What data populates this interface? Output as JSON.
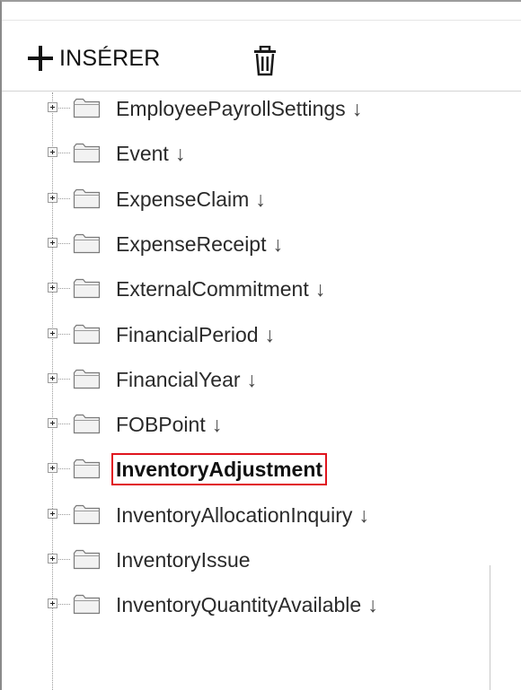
{
  "toolbar": {
    "insert_label": "INSÉRER",
    "insert_icon": "plus-icon",
    "delete_icon": "trash-icon"
  },
  "tree": {
    "sort_arrow": "↓",
    "selected_border_color": "#e0141e",
    "nodes": [
      {
        "label": "EmployeePayrollSettings",
        "sorted": true,
        "selected": false
      },
      {
        "label": "Event",
        "sorted": true,
        "selected": false
      },
      {
        "label": "ExpenseClaim",
        "sorted": true,
        "selected": false
      },
      {
        "label": "ExpenseReceipt",
        "sorted": true,
        "selected": false
      },
      {
        "label": "ExternalCommitment",
        "sorted": true,
        "selected": false
      },
      {
        "label": "FinancialPeriod",
        "sorted": true,
        "selected": false
      },
      {
        "label": "FinancialYear",
        "sorted": true,
        "selected": false
      },
      {
        "label": "FOBPoint",
        "sorted": true,
        "selected": false
      },
      {
        "label": "InventoryAdjustment",
        "sorted": false,
        "selected": true
      },
      {
        "label": "InventoryAllocationInquiry",
        "sorted": true,
        "selected": false
      },
      {
        "label": "InventoryIssue",
        "sorted": false,
        "selected": false
      },
      {
        "label": "InventoryQuantityAvailable",
        "sorted": true,
        "selected": false
      }
    ]
  }
}
